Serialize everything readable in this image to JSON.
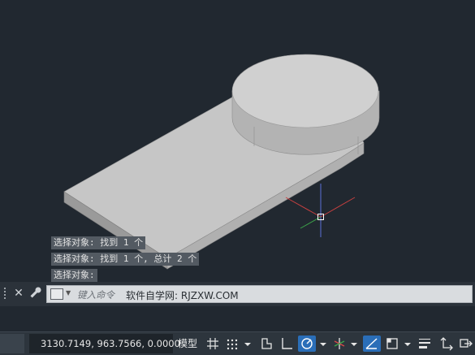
{
  "viewport": {
    "history": [
      "选择对象: 找到 1 个",
      "选择对象: 找到 1 个, 总计 2 个",
      "选择对象:"
    ]
  },
  "command_line": {
    "placeholder": "键入命令",
    "text": "软件自学网: RJZXW.COM"
  },
  "status_bar": {
    "coordinates": "3130.7149, 963.7566, 0.0000",
    "model_label": "模型",
    "icons": [
      "grid-icon",
      "snap-dots-icon",
      "dropdown-arrow",
      "infer-constraints-icon",
      "ortho-icon",
      "polar-icon",
      "dropdown-arrow",
      "isodraft-icon",
      "dropdown-arrow",
      "object-snap-tracking-icon",
      "object-snap-icon",
      "dropdown-arrow",
      "lineweight-icon",
      "ucs-icon",
      "selection-cycling-icon"
    ]
  },
  "colors": {
    "background": "#212830",
    "active_toggle": "#2a6eb8",
    "history_bg": "#535a62"
  }
}
